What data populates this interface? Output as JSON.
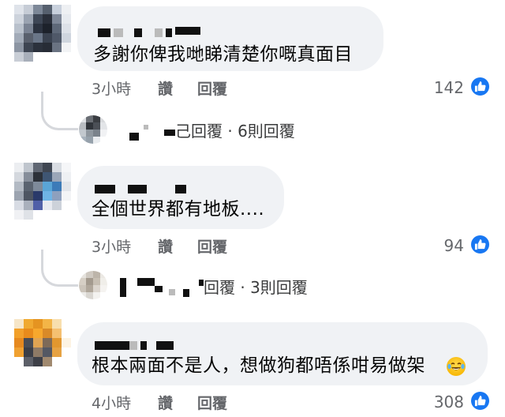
{
  "comments": [
    {
      "text": "多謝你俾我哋睇清楚你嘅真面目",
      "time": "3小時",
      "like_label": "讚",
      "reply_label": "回覆",
      "reactions": "142",
      "replies_summary": "己回覆 · 6則回覆"
    },
    {
      "text": "全個世界都有地板....",
      "time": "3小時",
      "like_label": "讚",
      "reply_label": "回覆",
      "reactions": "94",
      "replies_summary": "回覆 · 3則回覆"
    },
    {
      "text": "根本兩面不是人，想做狗都唔係咁易做架",
      "emoji": "face-with-tears-of-joy",
      "time": "4小時",
      "like_label": "讚",
      "reply_label": "回覆",
      "reactions": "308"
    }
  ],
  "colors": {
    "bubble_bg": "#f0f2f5",
    "meta_text": "#65676b",
    "like_blue": "#1877f2"
  }
}
